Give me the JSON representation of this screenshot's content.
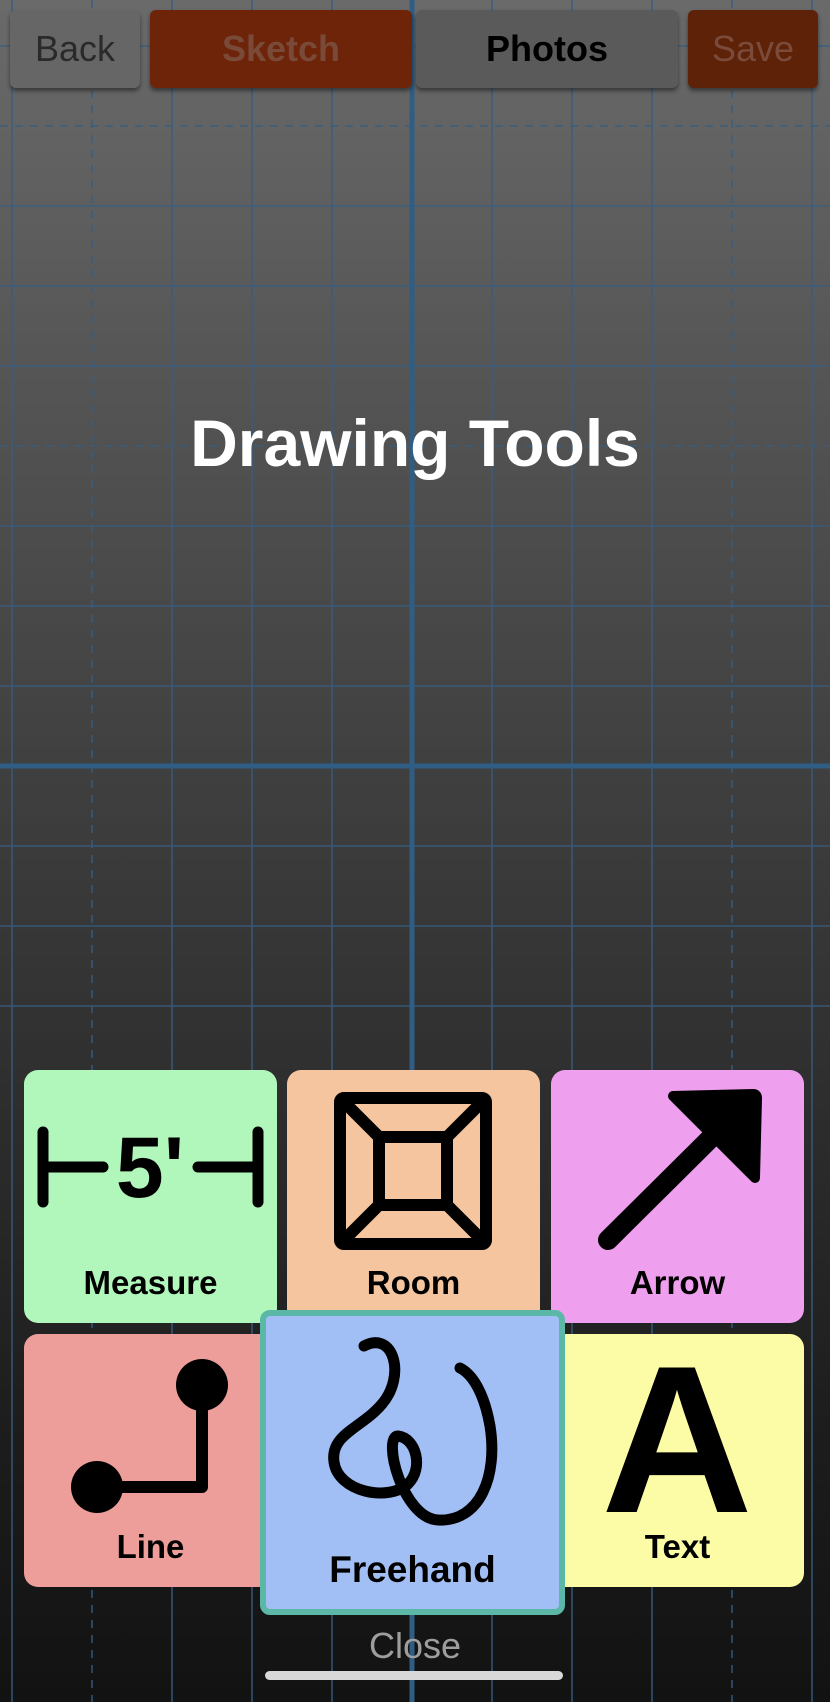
{
  "header": {
    "back_label": "Back",
    "tabs": [
      {
        "label": "Sketch",
        "active": true
      },
      {
        "label": "Photos",
        "active": false
      }
    ],
    "save_label": "Save"
  },
  "overlay": {
    "title": "Drawing Tools",
    "close_label": "Close"
  },
  "tools": [
    {
      "label": "Measure",
      "icon": "measure-icon",
      "color": "#b1f6bb",
      "glyph": "5'"
    },
    {
      "label": "Room",
      "icon": "room-icon",
      "color": "#f4c59f"
    },
    {
      "label": "Arrow",
      "icon": "arrow-icon",
      "color": "#ee9fee"
    },
    {
      "label": "Line",
      "icon": "line-icon",
      "color": "#ed9e9a"
    },
    {
      "label": "Freehand",
      "icon": "freehand-icon",
      "color": "#a2bff5",
      "selected": true
    },
    {
      "label": "Text",
      "icon": "text-icon",
      "color": "#fdfca6",
      "glyph": "A"
    }
  ],
  "colors": {
    "accent_sketch": "#6e2409",
    "selection_border": "#5bb8a7",
    "grid_line": "#2f5d84"
  }
}
